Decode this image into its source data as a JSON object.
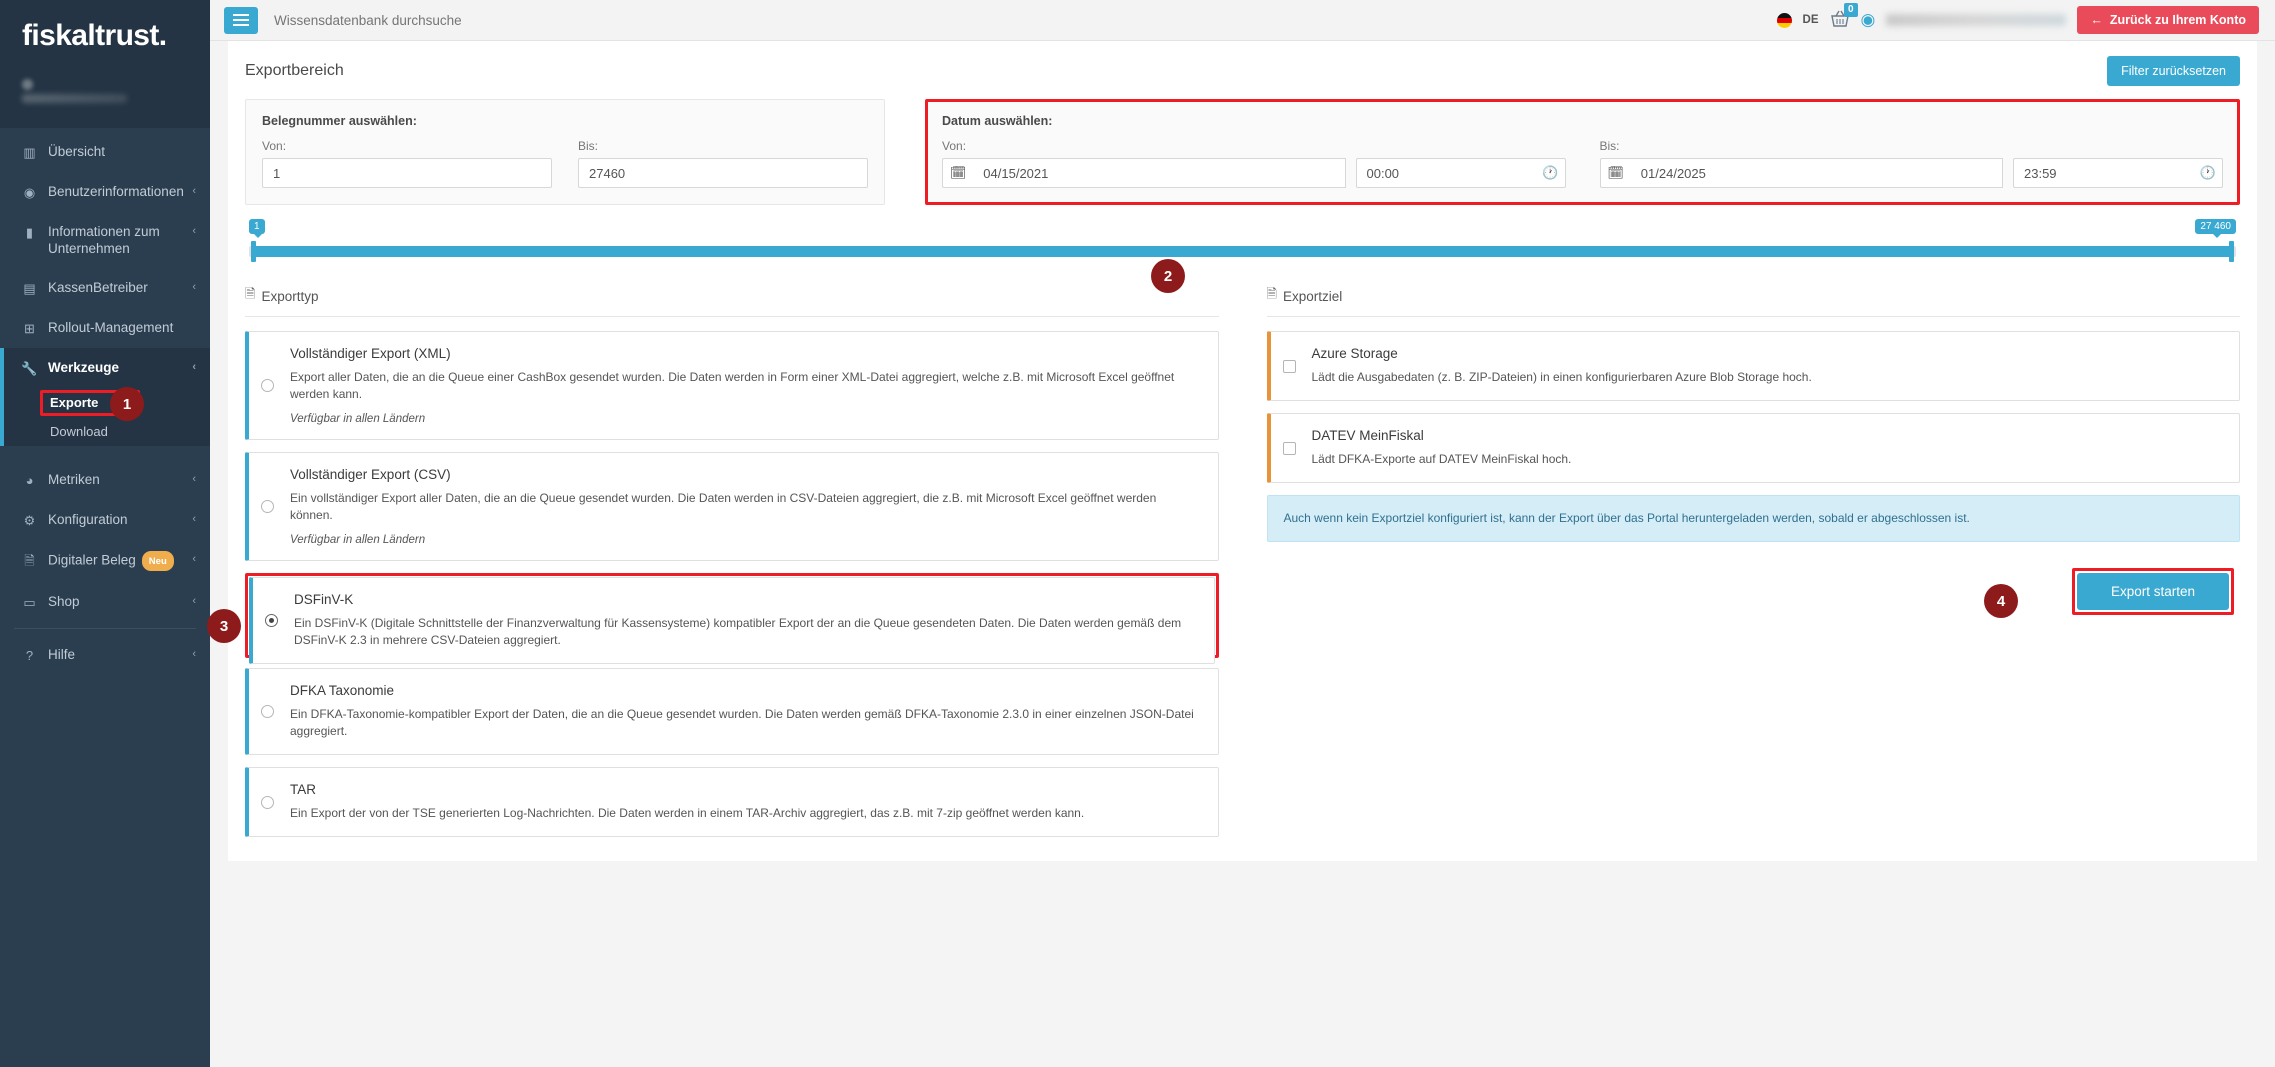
{
  "brand": {
    "logo": "fiskaltrust."
  },
  "sidebar": {
    "items": [
      {
        "label": "Übersicht",
        "icon": "chart-bar-icon",
        "chevron": ""
      },
      {
        "label": "Benutzerinformationen",
        "icon": "user-circle-icon",
        "chevron": "‹"
      },
      {
        "label": "Informationen zum Unternehmen",
        "icon": "briefcase-icon",
        "chevron": "‹"
      },
      {
        "label": "KassenBetreiber",
        "icon": "server-icon",
        "chevron": "‹"
      },
      {
        "label": "Rollout-Management",
        "icon": "plus-square-icon",
        "chevron": ""
      },
      {
        "label": "Werkzeuge",
        "icon": "wrench-icon",
        "chevron": "‹"
      }
    ],
    "sub_items": [
      {
        "label": "Exporte",
        "current": true
      },
      {
        "label": "Download",
        "current": false
      }
    ],
    "items_lower": [
      {
        "label": "Metriken",
        "icon": "pie-chart-icon",
        "chevron": "‹",
        "badge": ""
      },
      {
        "label": "Konfiguration",
        "icon": "cogs-icon",
        "chevron": "‹",
        "badge": ""
      },
      {
        "label": "Digitaler Beleg",
        "icon": "file-icon",
        "chevron": "‹",
        "badge": "Neu"
      },
      {
        "label": "Shop",
        "icon": "credit-card-icon",
        "chevron": "‹",
        "badge": ""
      }
    ],
    "help": {
      "label": "Hilfe",
      "icon": "question-circle-icon",
      "chevron": "‹"
    }
  },
  "topbar": {
    "menu_icon": "hamburger-icon",
    "search_placeholder": "Wissensdatenbank durchsuche",
    "search_value": "",
    "language": "DE",
    "flag_icon": "german-flag-icon",
    "cart_icon": "shopping-basket-icon",
    "cart_count": "0",
    "account_icon": "user-avatar-icon",
    "back_button": "Zurück zu Ihrem Konto",
    "back_arrow_icon": "arrow-left-icon"
  },
  "page": {
    "title": "Exportbereich",
    "reset_filter_button": "Filter zurücksetzen"
  },
  "beleg": {
    "panel_title": "Belegnummer auswählen:",
    "from_label": "Von:",
    "from_value": "1",
    "to_label": "Bis:",
    "to_value": "27460"
  },
  "datum": {
    "panel_title": "Datum auswählen:",
    "from_label": "Von:",
    "from_date": "04/15/2021",
    "from_time": "00:00",
    "to_label": "Bis:",
    "to_date": "01/24/2025",
    "to_time": "23:59",
    "calendar_icon": "calendar-icon",
    "clock_icon": "clock-icon"
  },
  "slider": {
    "min_label": "1",
    "max_label": "27 460"
  },
  "markers": {
    "m1": "1",
    "m2": "2",
    "m3": "3",
    "m4": "4"
  },
  "exporttyp": {
    "section_title": "Exporttyp",
    "section_icon": "file-icon",
    "options": [
      {
        "title": "Vollständiger Export (XML)",
        "desc": "Export aller Daten, die an die Queue einer CashBox gesendet wurden. Die Daten werden in Form einer XML-Datei aggregiert, welche z.B. mit Microsoft Excel geöffnet werden kann.",
        "note": "Verfügbar in allen Ländern",
        "selected": false
      },
      {
        "title": "Vollständiger Export (CSV)",
        "desc": "Ein vollständiger Export aller Daten, die an die Queue gesendet wurden. Die Daten werden in CSV-Dateien aggregiert, die z.B. mit Microsoft Excel geöffnet werden können.",
        "note": "Verfügbar in allen Ländern",
        "selected": false
      },
      {
        "title": "DSFinV-K",
        "desc": "Ein DSFinV-K (Digitale Schnittstelle der Finanzverwaltung für Kassensysteme) kompatibler Export der an die Queue gesendeten Daten. Die Daten werden gemäß dem DSFinV-K 2.3 in mehrere CSV-Dateien aggregiert.",
        "note": "",
        "selected": true
      },
      {
        "title": "DFKA Taxonomie",
        "desc": "Ein DFKA-Taxonomie-kompatibler Export der Daten, die an die Queue gesendet wurden. Die Daten werden gemäß DFKA-Taxonomie 2.3.0 in einer einzelnen JSON-Datei aggregiert.",
        "note": "",
        "selected": false
      },
      {
        "title": "TAR",
        "desc": "Ein Export der von der TSE generierten Log-Nachrichten. Die Daten werden in einem TAR-Archiv aggregiert, das z.B. mit 7-zip geöffnet werden kann.",
        "note": "",
        "selected": false
      }
    ]
  },
  "exportziel": {
    "section_title": "Exportziel",
    "section_icon": "file-icon",
    "options": [
      {
        "title": "Azure Storage",
        "desc": "Lädt die Ausgabedaten (z. B. ZIP-Dateien) in einen konfigurierbaren Azure Blob Storage hoch.",
        "checked": false
      },
      {
        "title": "DATEV MeinFiskal",
        "desc": "Lädt DFKA-Exporte auf DATEV MeinFiskal hoch.",
        "checked": false
      }
    ],
    "info": "Auch wenn kein Exportziel konfiguriert ist, kann der Export über das Portal heruntergeladen werden, sobald er abgeschlossen ist."
  },
  "footer": {
    "start_button": "Export starten"
  },
  "colors": {
    "accent": "#3aa9d1",
    "sidebar": "#2b3e50",
    "danger": "#ea4b5a",
    "highlight": "#ee1c24",
    "marker": "#8e1b1b",
    "orange": "#e8923a"
  }
}
